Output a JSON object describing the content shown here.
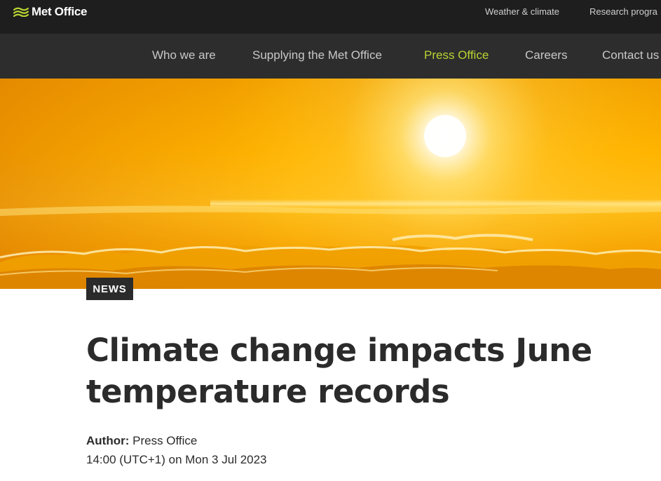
{
  "header": {
    "brand": "Met Office",
    "brand_icon": "met-office-logo-icon",
    "utility_links": [
      "Weather & climate",
      "Research progra"
    ]
  },
  "nav": {
    "items": [
      {
        "label": "Who we are"
      },
      {
        "label": "Supplying the Met Office"
      },
      {
        "label": "Press Office"
      },
      {
        "label": "Careers"
      },
      {
        "label": "Contact us"
      }
    ],
    "active": "Press Office",
    "active_color": "#b8d432"
  },
  "hero": {
    "image": "sun-above-clouds"
  },
  "article": {
    "category": "NEWS",
    "title": "Climate change impacts June temperature records",
    "author_label": "Author:",
    "author": "Press Office",
    "published": "14:00 (UTC+1) on Mon 3 Jul 2023"
  },
  "colors": {
    "topbar": "#1e1e1e",
    "nav": "#2d2d2d",
    "text": "#2b2b2b",
    "accent": "#b8d432"
  }
}
